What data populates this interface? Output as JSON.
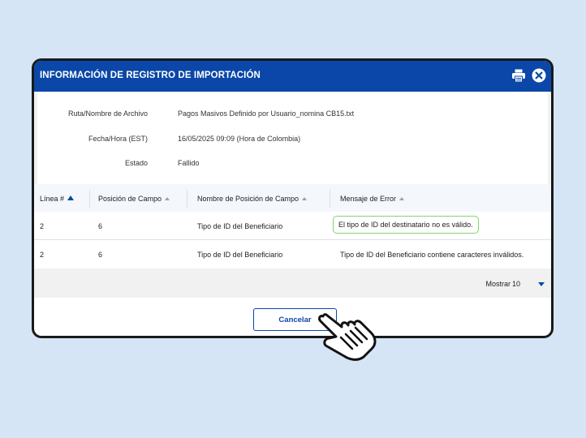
{
  "dialog": {
    "title": "INFORMACIÓN DE REGISTRO DE IMPORTACIÓN",
    "print_icon": "print-icon",
    "close_icon": "close-icon"
  },
  "info": [
    {
      "label": "Ruta/Nombre de Archivo",
      "value": "Pagos Masivos Definido por Usuario_nomina CB15.txt"
    },
    {
      "label": "Fecha/Hora (EST)",
      "value": "16/05/2025 09:09 (Hora de Colombia)"
    },
    {
      "label": "Estado",
      "value": "Fallido"
    }
  ],
  "table": {
    "columns": [
      "Línea #",
      "Posición de Campo",
      "Nombre de Posición de Campo",
      "Mensaje de Error"
    ],
    "sort_column": "Línea #",
    "rows": [
      [
        "2",
        "6",
        "Tipo de ID del Beneficiario",
        "El tipo de ID del destinatario no es válido."
      ],
      [
        "2",
        "6",
        "Tipo de ID del Beneficiario",
        "Tipo de ID del Beneficiario contiene caracteres inválidos."
      ]
    ]
  },
  "pagination": {
    "label": "Mostrar",
    "value": "10"
  },
  "actions": {
    "cancel_label": "Cancelar"
  },
  "colors": {
    "header": "#0a47a8",
    "background": "#d5e5f6",
    "highlight_border": "#7ed56f"
  }
}
